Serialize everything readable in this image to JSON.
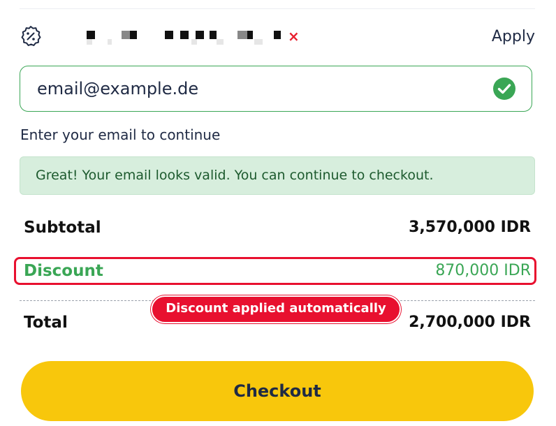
{
  "coupon": {
    "remove_symbol": "×",
    "apply_label": "Apply"
  },
  "email": {
    "value": "email@example.de",
    "placeholder": "email@example.de",
    "helper_text": "Enter your email to continue",
    "success_message": "Great! Your email looks valid. You can continue to checkout."
  },
  "summary": {
    "subtotal_label": "Subtotal",
    "subtotal_value": "3,570,000 IDR",
    "discount_label": "Discount",
    "discount_value": "870,000 IDR",
    "total_label": "Total",
    "total_value": "2,700,000 IDR"
  },
  "annotation": {
    "callout_text": "Discount applied automatically"
  },
  "checkout": {
    "button_label": "Checkout"
  },
  "colors": {
    "accent_green": "#3aa655",
    "success_bg": "#d7eedd",
    "alert_red": "#e8102f",
    "checkout_yellow": "#f8c70c",
    "text_dark": "#1f2a44"
  },
  "icons": {
    "coupon": "discount-badge-icon",
    "valid": "check-circle-icon",
    "remove": "close-icon"
  }
}
